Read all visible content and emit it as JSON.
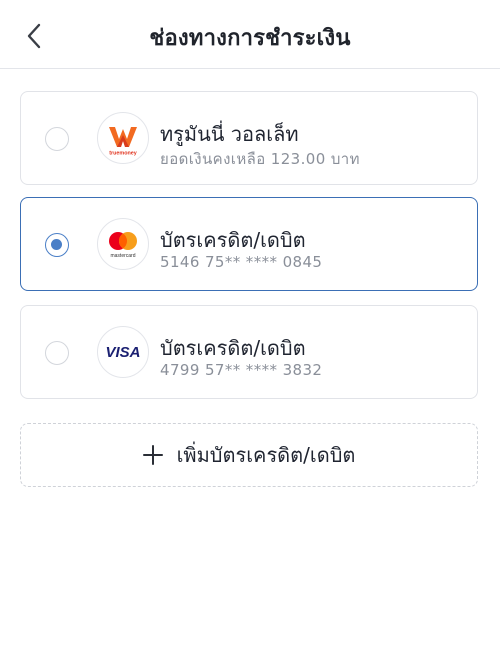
{
  "header": {
    "title": "ช่องทางการชำระเงิน",
    "back_icon": "chevron-left-icon"
  },
  "options": [
    {
      "title": "ทรูมันนี่ วอลเล็ท",
      "subtitle": "ยอดเงินคงเหลือ 123.00 บาท",
      "logo": "truemoney",
      "logo_text": "truemoney",
      "selected": false
    },
    {
      "title": "บัตรเครดิต/เดบิต",
      "subtitle": "5146 75** **** 0845",
      "logo": "mastercard",
      "logo_text": "mastercard",
      "selected": true
    },
    {
      "title": "บัตรเครดิต/เดบิต",
      "subtitle": "4799 57** **** 3832",
      "logo": "visa",
      "logo_text": "VISA",
      "selected": false
    }
  ],
  "add_card": {
    "label": "เพิ่มบัตรเครดิต/เดบิต",
    "icon": "plus-icon"
  },
  "colors": {
    "selected_border": "#3b6fb5",
    "radio_fill": "#4a7fc7",
    "truemoney_orange": "#f26a21",
    "mastercard_red": "#eb001b",
    "mastercard_yellow": "#f79e1b",
    "visa_navy": "#1a1f71"
  }
}
